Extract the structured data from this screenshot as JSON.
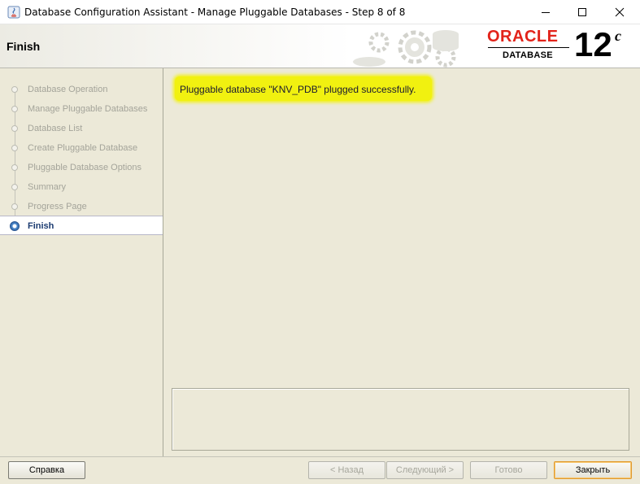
{
  "window": {
    "title": "Database Configuration Assistant - Manage Pluggable Databases - Step 8 of 8"
  },
  "header": {
    "title": "Finish",
    "logo_brand": "ORACLE",
    "logo_product": "DATABASE",
    "logo_version": "12",
    "logo_version_suffix": "c"
  },
  "sidebar": {
    "steps": [
      {
        "label": "Database Operation",
        "state": "done"
      },
      {
        "label": "Manage Pluggable Databases",
        "state": "done"
      },
      {
        "label": "Database List",
        "state": "done"
      },
      {
        "label": "Create Pluggable Database",
        "state": "done"
      },
      {
        "label": "Pluggable Database Options",
        "state": "done"
      },
      {
        "label": "Summary",
        "state": "done"
      },
      {
        "label": "Progress Page",
        "state": "done"
      },
      {
        "label": "Finish",
        "state": "active"
      }
    ]
  },
  "content": {
    "message": "Pluggable database \"KNV_PDB\" plugged successfully.",
    "highlight_color": "#f2f200"
  },
  "footer": {
    "help_label": "Справка",
    "back_label": "< Назад",
    "next_label": "Следующий >",
    "finish_label": "Готово",
    "close_label": "Закрыть"
  },
  "colors": {
    "oracle_red": "#e2231a",
    "panel_bg": "#ece9d8",
    "active_step_text": "#1a3a70"
  }
}
